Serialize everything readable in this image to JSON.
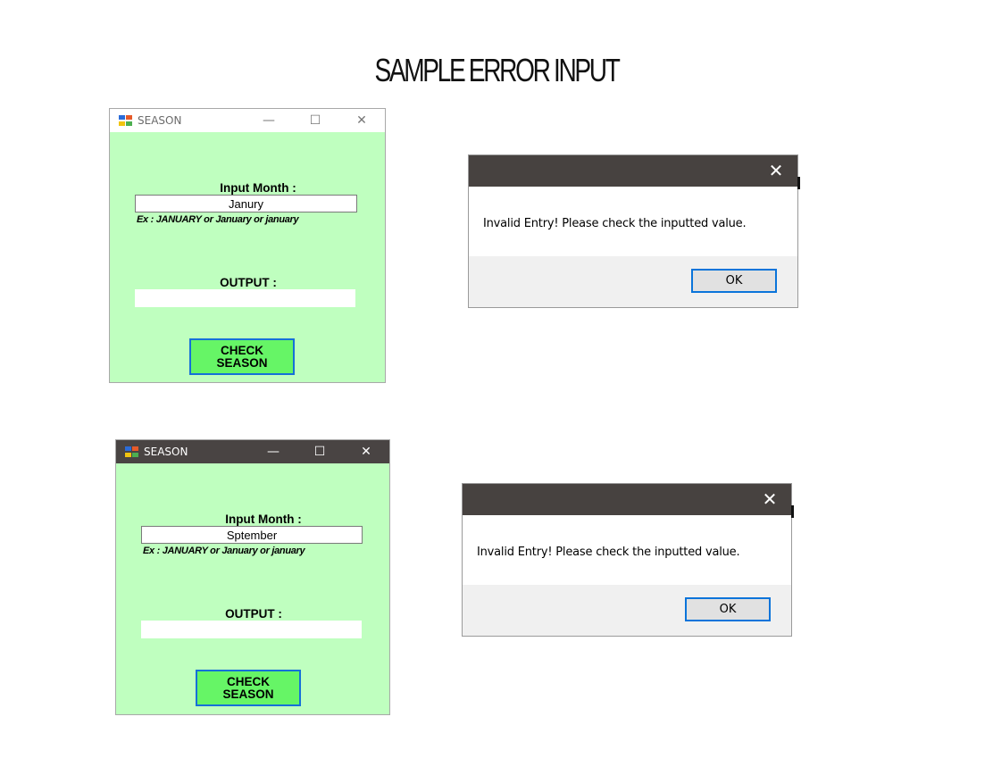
{
  "page": {
    "title": "SAMPLE ERROR INPUT"
  },
  "windows": [
    {
      "title": "SEASON",
      "minimize_glyph": "—",
      "maximize_glyph": "☐",
      "close_glyph": "✕",
      "input_label": "Input Month :",
      "input_value": "Janury",
      "hint": "Ex : JANUARY or January or january",
      "output_label": "OUTPUT :",
      "output_value": "",
      "button_label": "CHECK\nSEASON"
    },
    {
      "title": "SEASON",
      "minimize_glyph": "—",
      "maximize_glyph": "☐",
      "close_glyph": "✕",
      "input_label": "Input Month :",
      "input_value": "Sptember",
      "hint": "Ex : JANUARY or January or january",
      "output_label": "OUTPUT :",
      "output_value": "",
      "button_label": "CHECK\nSEASON"
    }
  ],
  "dialogs": [
    {
      "close_glyph": "✕",
      "message": "Invalid Entry! Please check the inputted value.",
      "ok_label": "OK"
    },
    {
      "close_glyph": "✕",
      "message": "Invalid Entry! Please check the inputted value.",
      "ok_label": "OK"
    }
  ],
  "colors": {
    "form_background": "#bfffbf",
    "button_background": "#66f566",
    "button_border": "#1570d8",
    "dialog_titlebar": "#474240",
    "ok_border": "#0a74da"
  },
  "icons": {
    "app": "windows-form-icon",
    "close": "close-icon",
    "minimize": "minimize-icon",
    "maximize": "maximize-icon"
  }
}
